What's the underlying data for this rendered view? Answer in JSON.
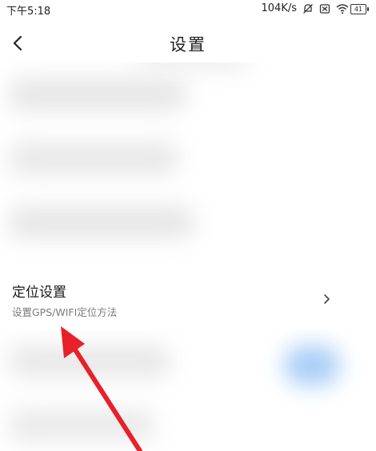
{
  "status_bar": {
    "time": "下午5:18",
    "net_speed": "104K/s",
    "battery": "41"
  },
  "header": {
    "title": "设置"
  },
  "setting_item": {
    "title": "定位设置",
    "subtitle": "设置GPS/WIFI定位方法"
  },
  "colors": {
    "arrow": "#e8202a",
    "blur_gray": "#e4e4e4",
    "blur_blue": "#a8cdf7"
  },
  "icons": [
    "back-arrow-icon",
    "mute-icon",
    "sim-icon",
    "wifi-icon",
    "battery-icon",
    "chevron-right-icon"
  ]
}
